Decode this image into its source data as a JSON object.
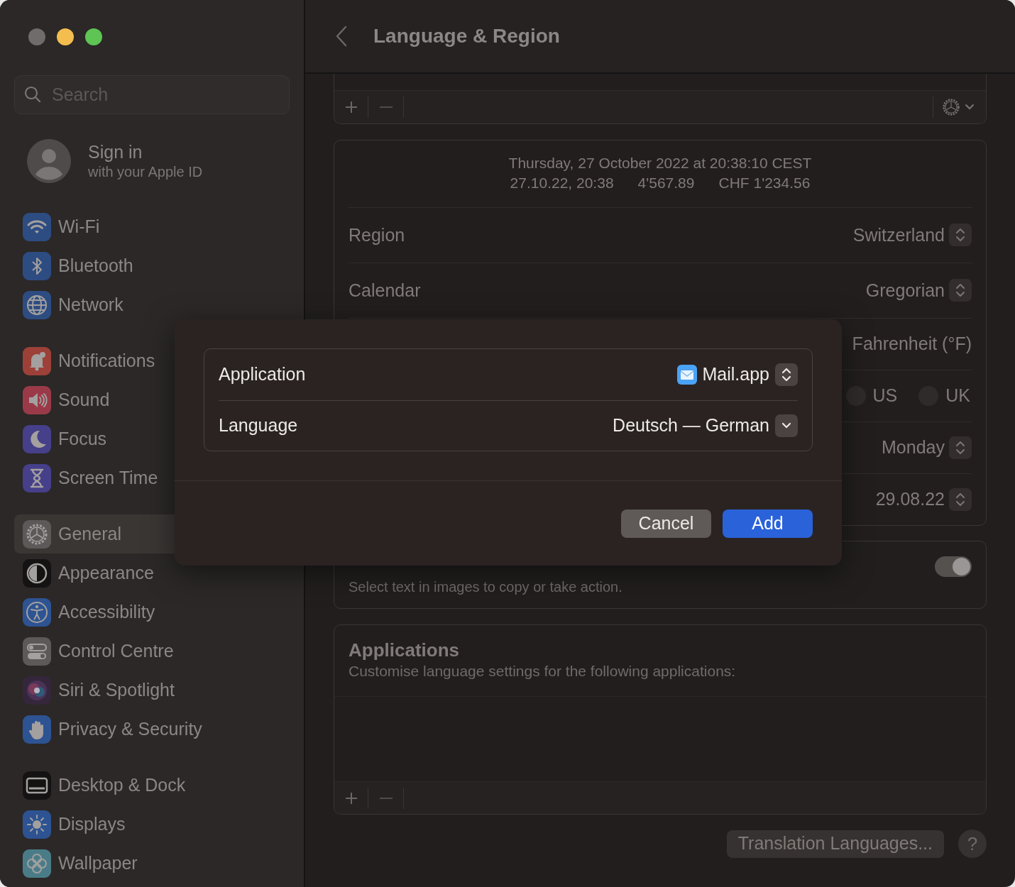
{
  "window": {
    "controls": [
      {
        "color": "#6f6c6b"
      },
      {
        "color": "#f4bd4f"
      },
      {
        "color": "#5ec454"
      }
    ]
  },
  "sidebar": {
    "search": {
      "placeholder": "Search"
    },
    "account": {
      "title": "Sign in",
      "subtitle": "with your Apple ID"
    },
    "groups": [
      {
        "items": [
          {
            "label": "Wi-Fi",
            "color": "#2d4c82",
            "selected": false
          },
          {
            "label": "Bluetooth",
            "color": "#2d4c82",
            "selected": false
          },
          {
            "label": "Network",
            "color": "#2d4c82",
            "selected": false
          }
        ]
      },
      {
        "items": [
          {
            "label": "Notifications",
            "color": "#9c4038",
            "selected": false
          },
          {
            "label": "Sound",
            "color": "#9a3a49",
            "selected": false
          },
          {
            "label": "Focus",
            "color": "#463f8a",
            "selected": false
          },
          {
            "label": "Screen Time",
            "color": "#463f8a",
            "selected": false
          }
        ]
      },
      {
        "items": [
          {
            "label": "General",
            "color": "#5c5958",
            "selected": true
          },
          {
            "label": "Appearance",
            "color": "#141212",
            "selected": false
          },
          {
            "label": "Accessibility",
            "color": "#2d5392",
            "selected": false
          },
          {
            "label": "Control Centre",
            "color": "#5c5958",
            "selected": false
          },
          {
            "label": "Siri & Spotlight",
            "color": "#35263c",
            "selected": false
          },
          {
            "label": "Privacy & Security",
            "color": "#2d5392",
            "selected": false
          }
        ]
      },
      {
        "items": [
          {
            "label": "Desktop & Dock",
            "color": "#141212",
            "selected": false
          },
          {
            "label": "Displays",
            "color": "#2d5392",
            "selected": false
          },
          {
            "label": "Wallpaper",
            "color": "#4a7c88",
            "selected": false
          }
        ]
      }
    ]
  },
  "header": {
    "title": "Language & Region"
  },
  "format": {
    "preview": [
      [
        "Thursday, 27 October 2022 at 20:38:10 CEST"
      ],
      [
        "27.10.22, 20:38",
        "4'567.89",
        "CHF 1'234.56"
      ]
    ],
    "rows": [
      {
        "kind": "stepper",
        "label": "Region",
        "value": "Switzerland"
      },
      {
        "kind": "stepper",
        "label": "Calendar",
        "value": "Gregorian"
      },
      {
        "kind": "text",
        "value": "Fahrenheit (°F)"
      },
      {
        "kind": "radios",
        "options": [
          {
            "label": "US",
            "selected": false
          },
          {
            "label": "UK",
            "selected": false
          }
        ]
      },
      {
        "kind": "stepper",
        "value": "Monday"
      },
      {
        "kind": "stepper",
        "value": "29.08.22"
      }
    ]
  },
  "live_text": {
    "subtitle": "Select text in images to copy or take action.",
    "on": true
  },
  "applications": {
    "title": "Applications",
    "subtitle": "Customise language settings for the following applications:"
  },
  "footer": {
    "translation_button": "Translation Languages...",
    "help_button": "?"
  },
  "dialog": {
    "rows": [
      {
        "kind": "stepper",
        "label": "Application",
        "value": "Mail.app",
        "app_icon": true
      },
      {
        "kind": "dropdown",
        "label": "Language",
        "value": "Deutsch — German"
      }
    ],
    "buttons": [
      {
        "kind": "secondary",
        "label": "Cancel"
      },
      {
        "kind": "primary",
        "label": "Add"
      }
    ]
  }
}
